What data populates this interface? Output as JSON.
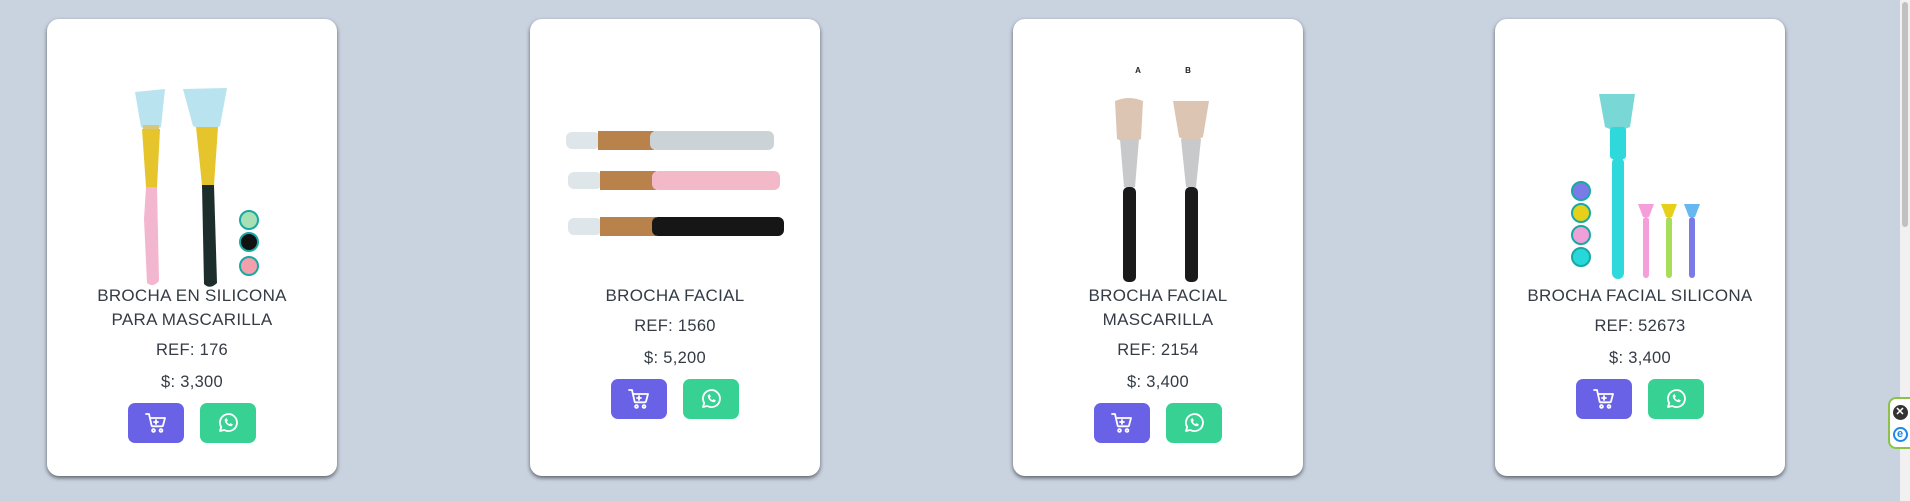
{
  "products": [
    {
      "title_line1": "BROCHA EN SILICONA",
      "title_line2": "PARA MASCARILLA",
      "ref": "REF: 176",
      "price": "$: 3,300",
      "swatch_colors": [
        "#a8e0b5",
        "#111111",
        "#f2a0ac"
      ]
    },
    {
      "title_line1": "BROCHA FACIAL",
      "title_line2": "",
      "ref": "REF: 1560",
      "price": "$: 5,200"
    },
    {
      "title_line1": "BROCHA FACIAL",
      "title_line2": "MASCARILLA",
      "ref": "REF: 2154",
      "price": "$: 3,400",
      "variant_labels": [
        "A",
        "B"
      ]
    },
    {
      "title_line1": "BROCHA FACIAL SILICONA",
      "title_line2": "",
      "ref": "REF: 52673",
      "price": "$: 3,400",
      "swatch_colors": [
        "#7b7be8",
        "#e6d019",
        "#f0a0d8",
        "#27d7d9"
      ]
    }
  ],
  "icons": {
    "cart": "cart-icon",
    "whatsapp": "whatsapp-icon",
    "widget_close": "close-icon",
    "widget_e": "e-icon"
  },
  "widget": {
    "e_label": "e",
    "close_label": "✕"
  },
  "colors": {
    "background": "#c9d3e0",
    "cart_button": "#6a62e6",
    "whatsapp_button": "#37d293",
    "text": "#333b45"
  }
}
